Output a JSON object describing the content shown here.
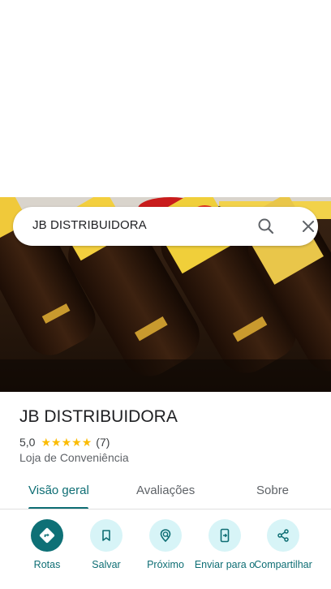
{
  "search": {
    "query": "JB DISTRIBUIDORA"
  },
  "place": {
    "name": "JB DISTRIBUIDORA",
    "rating": "5,0",
    "stars": 5,
    "review_count": "(7)",
    "category": "Loja de Conveniência"
  },
  "tabs": [
    {
      "label": "Visão geral",
      "active": true
    },
    {
      "label": "Avaliações",
      "active": false
    },
    {
      "label": "Sobre",
      "active": false
    }
  ],
  "actions": [
    {
      "label": "Rotas",
      "icon": "directions-icon"
    },
    {
      "label": "Salvar",
      "icon": "bookmark-icon"
    },
    {
      "label": "Próximo",
      "icon": "nearby-icon"
    },
    {
      "label": "Enviar para o",
      "icon": "send-to-phone-icon"
    },
    {
      "label": "Compartilhar",
      "icon": "share-icon"
    }
  ],
  "colors": {
    "accent": "#0e6e74",
    "action_bg": "#d7f4f7",
    "star": "#fbbc04"
  }
}
